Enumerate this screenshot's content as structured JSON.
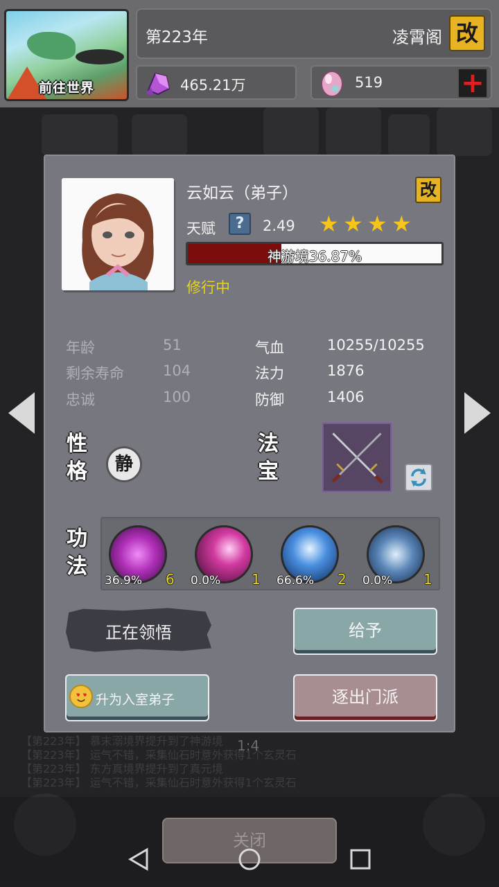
{
  "header": {
    "world_button_label": "前往世界",
    "year": "第223年",
    "sect_name": "凌霄阁",
    "rename_label": "改",
    "currency_primary": "465.21万",
    "currency_secondary": "519",
    "add_label": "+"
  },
  "background": {
    "log_lines": [
      "【第223年】 慕末溺境界提升到了神游境",
      "【第223年】 运气不错，采集仙石时意外获得1个玄灵石",
      "【第223年】 东方真境界提升到了真元境",
      "【第223年】 运气不错，采集仙石时意外获得1个玄灵石"
    ],
    "ratio": "1:4",
    "close_label": "关闭"
  },
  "dialog": {
    "name": "云如云（弟子）",
    "rename_label": "改",
    "talent_label": "天赋",
    "help_label": "?",
    "talent_value": "2.49",
    "stars": 4,
    "realm_text": "神游境36.87%",
    "realm_progress": 0.3687,
    "status": "修行中",
    "attributes_left": [
      {
        "label": "年龄",
        "value": "51"
      },
      {
        "label": "剩余寿命",
        "value": "104"
      },
      {
        "label": "忠诚",
        "value": "100"
      }
    ],
    "attributes_right": [
      {
        "label": "气血",
        "value": "10255/10255"
      },
      {
        "label": "法力",
        "value": "1876"
      },
      {
        "label": "防御",
        "value": "1406"
      }
    ],
    "personality_title_1": "性",
    "personality_title_2": "格",
    "personality_badge": "静",
    "treasure_title_1": "法",
    "treasure_title_2": "宝",
    "skills_title_1": "功",
    "skills_title_2": "法",
    "skills": [
      {
        "progress": "36.9%",
        "level": "6",
        "color": "#b02fb8"
      },
      {
        "progress": "0.0%",
        "level": "1",
        "color": "#c02a8e"
      },
      {
        "progress": "66.6%",
        "level": "2",
        "color": "#2f6fd0"
      },
      {
        "progress": "0.0%",
        "level": "1",
        "color": "#3a6fb0"
      }
    ],
    "buttons": {
      "comprehending": "正在领悟",
      "give": "给予",
      "promote": "升为入室弟子",
      "expel": "逐出门派"
    }
  }
}
